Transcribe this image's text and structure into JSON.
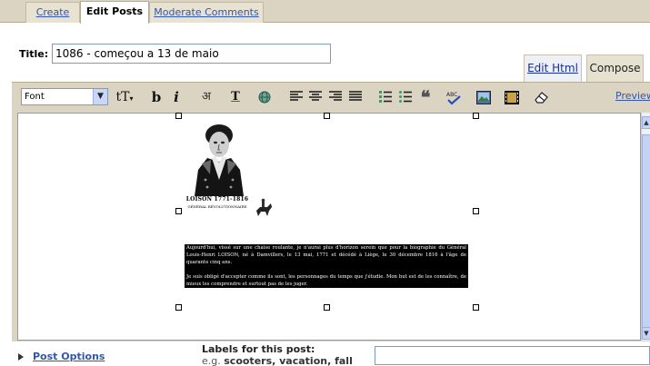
{
  "tabs": {
    "create": "Create",
    "edit_posts": "Edit Posts",
    "moderate_comments": "Moderate Comments"
  },
  "title_field": {
    "label": "Title:",
    "value": "1086 - começou a 13 de maio"
  },
  "editor_modes": {
    "edit_html": "Edit Html",
    "compose": "Compose"
  },
  "toolbar": {
    "font_select": "Font",
    "font_size_icon": "tT",
    "bold": "b",
    "italic": "i",
    "text_color_icon": "अ",
    "highlight_icon": "T",
    "preview": "Preview"
  },
  "content": {
    "portrait_caption": "LOISON 1771-1816",
    "portrait_subcaption": "GÉNÉRAL RÉVOLUTIONNAIRE",
    "paragraph_1": "Aujourd'hui, vissé sur une chaise roulante, je n'aurai plus d'horizon serein que pour la biographie du Général Louis-Henri LOISON, né à Damvillers, le 13 mai, 1771 et décédé à Liège, le 30 décembre 1816 à l'âge de quarante cinq ans.",
    "paragraph_2": "Je suis obligé d'accepter comme ils sont, les personnages du temps que j'étudie. Mon but est de les connaître, de mieux les comprendre et surtout pas de les juger."
  },
  "footer": {
    "post_options": "Post Options",
    "labels_title": "Labels for this post:",
    "labels_eg_prefix": "e.g.",
    "labels_eg_examples": "scooters, vacation, fall",
    "labels_value": ""
  },
  "colors": {
    "chrome_beige": "#dcd4c2",
    "link_blue": "#3355aa"
  }
}
